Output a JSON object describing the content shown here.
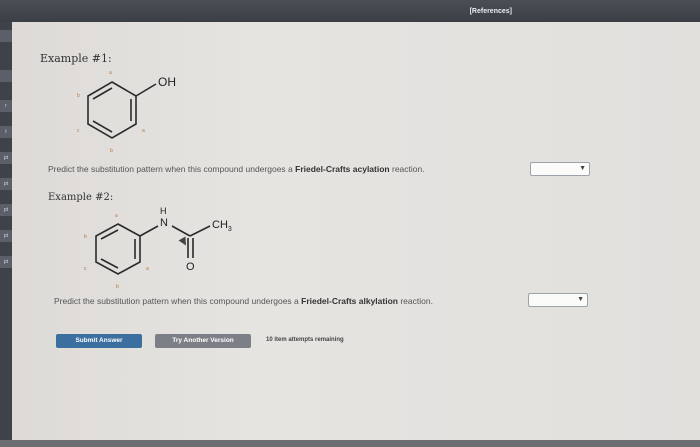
{
  "header": {
    "references_label": "[References]"
  },
  "sidebar": {
    "tabs": [
      "",
      "",
      "r",
      "t",
      "pt",
      "pt",
      "pt",
      "pt",
      "pt"
    ]
  },
  "example1": {
    "title": "Example #1:",
    "substituent": "OH",
    "position_labels": {
      "a_top": "a",
      "b_left": "b",
      "c_left": "c",
      "b_bottom": "b",
      "a_right": "a"
    },
    "question_prefix": "Predict the substitution pattern when this compound undergoes a ",
    "question_bold": "Friedel-Crafts acylation",
    "question_suffix": " reaction.",
    "selected_value": ""
  },
  "example2": {
    "title": "Example #2:",
    "atom_N": "N",
    "atom_H": "H",
    "atom_O": "O",
    "substituent": "CH",
    "substituent_sub": "3",
    "position_labels": {
      "a_top": "a",
      "b_left": "b",
      "c_left": "c",
      "b_bottom": "b",
      "a_right": "a"
    },
    "question_prefix": "Predict the substitution pattern when this compound undergoes a ",
    "question_bold": "Friedel-Crafts alkylation",
    "question_suffix": " reaction.",
    "selected_value": ""
  },
  "actions": {
    "submit_label": "Submit Answer",
    "try_another_label": "Try Another Version",
    "attempts_text": "10 item attempts remaining"
  },
  "colors": {
    "topbar": "#3b3f45",
    "primary_button": "#3a6f9f",
    "secondary_button": "#7c8086",
    "position_label": "#b07a3e"
  }
}
